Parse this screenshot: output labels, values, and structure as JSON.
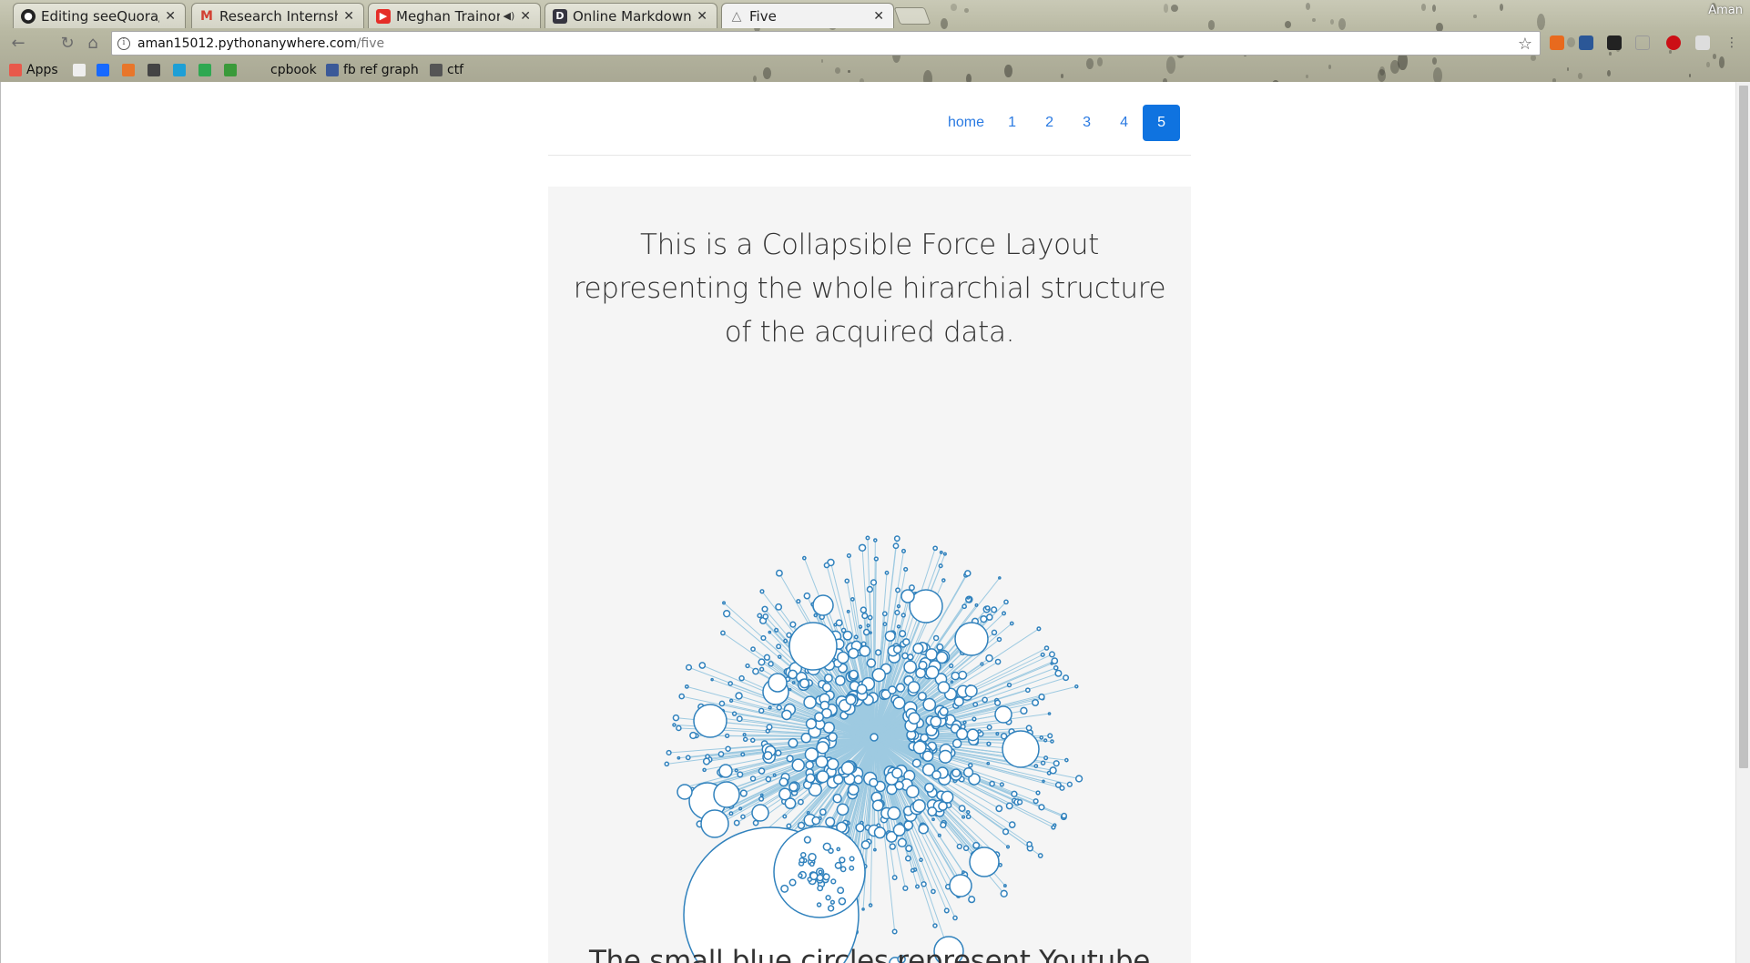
{
  "browser": {
    "tabs": [
      {
        "title": "Editing seeQuora/f",
        "favicon": "github-icon",
        "active": false
      },
      {
        "title": "Research Internshi",
        "favicon": "gmail-icon",
        "active": false
      },
      {
        "title": "Meghan Trainor",
        "favicon": "youtube-icon",
        "active": false,
        "audio": true
      },
      {
        "title": "Online Markdown E",
        "favicon": "dillinger-icon",
        "active": false
      },
      {
        "title": "Five",
        "favicon": "triangle-icon",
        "active": true
      }
    ],
    "profile_name": "Aman",
    "url_host": "aman15012.pythonanywhere.com",
    "url_path": "/five",
    "bookmarks": [
      {
        "label": "Apps",
        "icon": "apps-grid-icon"
      },
      {
        "label": "",
        "icon": "page-icon"
      },
      {
        "label": "",
        "icon": "behance-icon"
      },
      {
        "label": "",
        "icon": "plus-square-icon"
      },
      {
        "label": "",
        "icon": "nb-icon"
      },
      {
        "label": "",
        "icon": "s-icon"
      },
      {
        "label": "",
        "icon": "drive-icon"
      },
      {
        "label": "",
        "icon": "wb-icon"
      },
      {
        "label": "cpbook",
        "icon": "blank-icon"
      },
      {
        "label": "fb ref graph",
        "icon": "facebook-icon"
      },
      {
        "label": "ctf",
        "icon": "ctf-icon"
      }
    ]
  },
  "nav": {
    "items": [
      "home",
      "1",
      "2",
      "3",
      "4",
      "5"
    ],
    "active_index": 5
  },
  "content": {
    "intro": "This is a Collapsible Force Layout representing the whole hirarchial structure of the acquired data.",
    "next_paragraph": "The small blue circles represent Youtube"
  },
  "colors": {
    "accent": "#0f73e0",
    "link": "#2a7ae2",
    "node_stroke": "#3182bd",
    "link_stroke": "#9ecae1",
    "panel_bg": "#f5f5f5"
  }
}
